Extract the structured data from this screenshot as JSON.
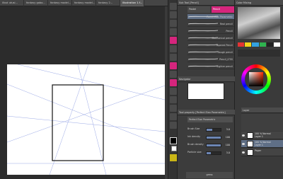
{
  "tabs": [
    "illust utusi...",
    "fantasy gobo...",
    "fantasy model...",
    "fantasy model...",
    "fantasy 2...",
    "illustration 1.f..."
  ],
  "active_tab_index": 5,
  "subtool": {
    "tabs": [
      "Pastel",
      "Pencil"
    ],
    "header_label": "Sub Tool [Pencil]",
    "brushes": [
      "Pencil Elan Parametric",
      "Real pencil",
      "Pencil",
      "Mechanical pencil",
      "Tapered Pencil",
      "Rough pencil",
      "Pencil_LTSS",
      "Lighter pencil"
    ],
    "selected_brush_index": 0
  },
  "navigator_label": "Navigator",
  "tool_property": {
    "header_label": "Tool property [Perfect Elan Parametric]",
    "brush_name": "Perfect Elan Parametric",
    "rows": [
      {
        "label": "Brush Size",
        "value": "3.0"
      },
      {
        "label": "Ink density",
        "value": "100"
      },
      {
        "label": "Brush density",
        "value": "100"
      },
      {
        "label": "Particle size",
        "value": "3.0"
      }
    ]
  },
  "layers": {
    "header_label": "Layer",
    "rows": [
      {
        "name": "100 % Normal",
        "sub": "Layer 1"
      },
      {
        "name": "100 % Normal",
        "sub": "Layer 1"
      },
      {
        "name": "Paper",
        "sub": ""
      }
    ],
    "selected_index": 1
  },
  "color_mixing_label": "Color Mixing",
  "bottom_label": "gress",
  "colors": {
    "accent": "#d6257d",
    "selection": "#5f6f86",
    "swatches": [
      "#e33333",
      "#f2d219",
      "#33a2e0",
      "#2fb34f",
      "#222222",
      "#ffffff"
    ]
  }
}
